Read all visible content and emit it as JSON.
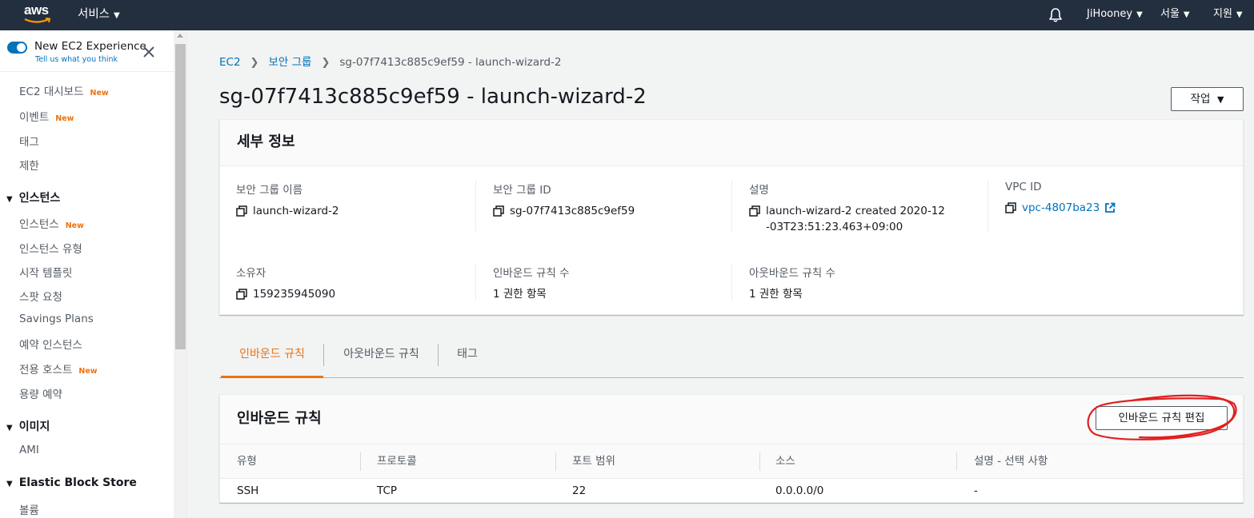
{
  "topnav": {
    "logo": "aws",
    "services": "서비스",
    "user": "JiHooney",
    "region": "서울",
    "support": "지원"
  },
  "sidebar": {
    "experience_title": "New EC2 Experience",
    "experience_sub": "Tell us what you think",
    "new_badge": "New",
    "items": [
      {
        "label": "EC2 대시보드",
        "new": true
      },
      {
        "label": "이벤트",
        "new": true
      },
      {
        "label": "태그",
        "new": false
      },
      {
        "label": "제한",
        "new": false
      }
    ],
    "section_instances": "인스턴스",
    "instance_items": [
      {
        "label": "인스턴스",
        "new": true
      },
      {
        "label": "인스턴스 유형",
        "new": false
      },
      {
        "label": "시작 템플릿",
        "new": false
      },
      {
        "label": "스팟 요청",
        "new": false
      },
      {
        "label": "Savings Plans",
        "new": false
      },
      {
        "label": "예약 인스턴스",
        "new": false
      },
      {
        "label": "전용 호스트",
        "new": true
      },
      {
        "label": "용량 예약",
        "new": false
      }
    ],
    "section_images": "이미지",
    "image_items": [
      {
        "label": "AMI"
      }
    ],
    "section_ebs": "Elastic Block Store",
    "ebs_items": [
      {
        "label": "볼륨"
      }
    ]
  },
  "breadcrumb": {
    "root": "EC2",
    "parent": "보안 그룹",
    "current": "sg-07f7413c885c9ef59 - launch-wizard-2"
  },
  "page": {
    "title": "sg-07f7413c885c9ef59 - launch-wizard-2",
    "actions": "작업"
  },
  "details": {
    "header": "세부 정보",
    "sg_name_label": "보안 그룹 이름",
    "sg_name": "launch-wizard-2",
    "sg_id_label": "보안 그룹 ID",
    "sg_id": "sg-07f7413c885c9ef59",
    "desc_label": "설명",
    "desc": "launch-wizard-2 created 2020-12-03T23:51:23.463+09:00",
    "vpc_label": "VPC ID",
    "vpc": "vpc-4807ba23",
    "owner_label": "소유자",
    "owner": "159235945090",
    "inbound_count_label": "인바운드 규칙 수",
    "inbound_count": "1 권한 항목",
    "outbound_count_label": "아웃바운드 규칙 수",
    "outbound_count": "1 권한 항목"
  },
  "tabs": [
    {
      "label": "인바운드 규칙",
      "active": true
    },
    {
      "label": "아웃바운드 규칙",
      "active": false
    },
    {
      "label": "태그",
      "active": false
    }
  ],
  "rules": {
    "header": "인바운드 규칙",
    "edit_button": "인바운드 규칙 편집",
    "columns": [
      "유형",
      "프로토콜",
      "포트 범위",
      "소스",
      "설명 - 선택 사항"
    ],
    "rows": [
      [
        "SSH",
        "TCP",
        "22",
        "0.0.0.0/0",
        "-"
      ]
    ]
  },
  "colors": {
    "nav_bg": "#232f3e",
    "link": "#0073bb",
    "accent": "#ec7211",
    "annotation": "#e02020"
  }
}
